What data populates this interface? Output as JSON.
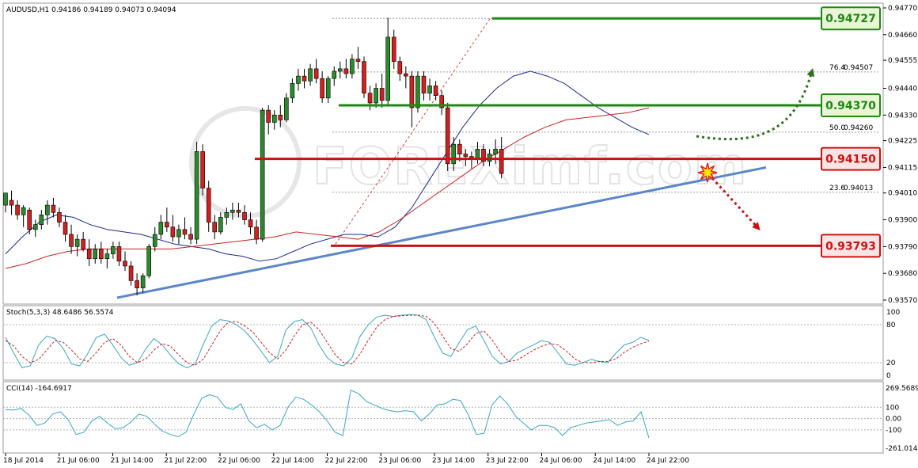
{
  "chart_data": {
    "type": "candlestick",
    "symbol_header": "AUDUSD,H1  0.94186 0.94189 0.94073 0.94094",
    "watermark": "FOREXimf.com",
    "x_ticks": [
      "18 Jul 2014",
      "21 Jul 06:00",
      "21 Jul 14:00",
      "21 Jul 22:00",
      "22 Jul 06:00",
      "22 Jul 14:00",
      "22 Jul 22:00",
      "23 Jul 06:00",
      "23 Jul 14:00",
      "23 Jul 22:00",
      "24 Jul 06:00",
      "24 Jul 14:00",
      "24 Jul 22:00"
    ],
    "y_ticks": [
      "0.94770",
      "0.94660",
      "0.94555",
      "0.94440",
      "0.94330",
      "0.94225",
      "0.94115",
      "0.94010",
      "0.93900",
      "0.93790",
      "0.93680",
      "0.93570"
    ],
    "ylim": [
      0.9357,
      0.9477
    ],
    "levels": [
      {
        "label": "0.94727",
        "value": 0.94727,
        "color": "#1e8a12",
        "kind": "resistance"
      },
      {
        "label": "0.94370",
        "value": 0.9437,
        "color": "#1e8a12",
        "kind": "resistance"
      },
      {
        "label": "0.94150",
        "value": 0.9415,
        "color": "#cc1111",
        "kind": "support"
      },
      {
        "label": "0.93793",
        "value": 0.93793,
        "color": "#cc1111",
        "kind": "support"
      }
    ],
    "fib_levels": [
      {
        "ratio": "76.4",
        "value_label": "0.94507",
        "value": 0.94507
      },
      {
        "ratio": "50.0",
        "value_label": "0.94260",
        "value": 0.9426
      },
      {
        "ratio": "23.6",
        "value_label": "0.94013",
        "value": 0.94013
      }
    ],
    "candles": [
      [
        0.9396,
        0.94,
        0.9393,
        0.9401
      ],
      [
        0.9398,
        0.9402,
        0.9392,
        0.9396
      ],
      [
        0.9396,
        0.9398,
        0.939,
        0.9392
      ],
      [
        0.9392,
        0.9396,
        0.9387,
        0.9395
      ],
      [
        0.9394,
        0.9395,
        0.9384,
        0.9386
      ],
      [
        0.9386,
        0.939,
        0.9383,
        0.9388
      ],
      [
        0.9388,
        0.9394,
        0.9386,
        0.9392
      ],
      [
        0.9392,
        0.9398,
        0.9388,
        0.9396
      ],
      [
        0.9396,
        0.9399,
        0.9391,
        0.9393
      ],
      [
        0.9393,
        0.9395,
        0.9387,
        0.9389
      ],
      [
        0.9389,
        0.9392,
        0.9381,
        0.9384
      ],
      [
        0.9384,
        0.9388,
        0.9376,
        0.9379
      ],
      [
        0.9379,
        0.9384,
        0.9375,
        0.9382
      ],
      [
        0.9382,
        0.9385,
        0.9377,
        0.9378
      ],
      [
        0.9378,
        0.9382,
        0.9371,
        0.9374
      ],
      [
        0.9374,
        0.938,
        0.9372,
        0.9378
      ],
      [
        0.9378,
        0.9381,
        0.9372,
        0.9374
      ],
      [
        0.9374,
        0.9378,
        0.937,
        0.9376
      ],
      [
        0.9376,
        0.9381,
        0.9374,
        0.9379
      ],
      [
        0.9379,
        0.9381,
        0.9371,
        0.9373
      ],
      [
        0.9373,
        0.9377,
        0.9369,
        0.9371
      ],
      [
        0.9371,
        0.9373,
        0.9363,
        0.9365
      ],
      [
        0.9365,
        0.9368,
        0.9359,
        0.9362
      ],
      [
        0.9362,
        0.9368,
        0.936,
        0.9367
      ],
      [
        0.9367,
        0.938,
        0.9366,
        0.9379
      ],
      [
        0.9379,
        0.9387,
        0.9377,
        0.9384
      ],
      [
        0.9384,
        0.9392,
        0.9382,
        0.9389
      ],
      [
        0.9389,
        0.9395,
        0.9385,
        0.9387
      ],
      [
        0.9387,
        0.9392,
        0.9381,
        0.9383
      ],
      [
        0.9383,
        0.9388,
        0.938,
        0.9386
      ],
      [
        0.9386,
        0.9391,
        0.9382,
        0.9384
      ],
      [
        0.9384,
        0.9387,
        0.938,
        0.9382
      ],
      [
        0.9382,
        0.9422,
        0.938,
        0.9418
      ],
      [
        0.9418,
        0.9421,
        0.94,
        0.9403
      ],
      [
        0.9403,
        0.9406,
        0.9385,
        0.9389
      ],
      [
        0.9389,
        0.9392,
        0.9382,
        0.9385
      ],
      [
        0.9385,
        0.9393,
        0.9384,
        0.9391
      ],
      [
        0.9391,
        0.9395,
        0.9388,
        0.9393
      ],
      [
        0.9393,
        0.9397,
        0.939,
        0.9394
      ],
      [
        0.9394,
        0.9397,
        0.9391,
        0.9393
      ],
      [
        0.9393,
        0.9396,
        0.9388,
        0.939
      ],
      [
        0.939,
        0.9393,
        0.9384,
        0.9387
      ],
      [
        0.9387,
        0.939,
        0.938,
        0.9382
      ],
      [
        0.9382,
        0.9436,
        0.9381,
        0.9435
      ],
      [
        0.9435,
        0.9437,
        0.9425,
        0.943
      ],
      [
        0.943,
        0.9435,
        0.9427,
        0.9433
      ],
      [
        0.9433,
        0.9437,
        0.9428,
        0.9431
      ],
      [
        0.9431,
        0.9442,
        0.943,
        0.944
      ],
      [
        0.944,
        0.9448,
        0.9438,
        0.9446
      ],
      [
        0.9446,
        0.9452,
        0.9443,
        0.9449
      ],
      [
        0.9449,
        0.9452,
        0.9444,
        0.9447
      ],
      [
        0.9447,
        0.9454,
        0.9445,
        0.9452
      ],
      [
        0.9452,
        0.9456,
        0.9446,
        0.9448
      ],
      [
        0.9448,
        0.9451,
        0.9438,
        0.944
      ],
      [
        0.944,
        0.9449,
        0.9438,
        0.9448
      ],
      [
        0.9448,
        0.9453,
        0.9445,
        0.9451
      ],
      [
        0.9451,
        0.9455,
        0.9448,
        0.9452
      ],
      [
        0.9452,
        0.9456,
        0.9448,
        0.945
      ],
      [
        0.945,
        0.9458,
        0.9448,
        0.9456
      ],
      [
        0.9456,
        0.9461,
        0.9452,
        0.9455
      ],
      [
        0.9455,
        0.9457,
        0.944,
        0.9442
      ],
      [
        0.9442,
        0.9445,
        0.9435,
        0.9438
      ],
      [
        0.9438,
        0.9446,
        0.9436,
        0.9444
      ],
      [
        0.9444,
        0.945,
        0.9436,
        0.9439
      ],
      [
        0.9439,
        0.9473,
        0.9437,
        0.9465
      ],
      [
        0.9465,
        0.9468,
        0.9452,
        0.9455
      ],
      [
        0.9455,
        0.9457,
        0.9447,
        0.945
      ],
      [
        0.945,
        0.9453,
        0.9444,
        0.9449
      ],
      [
        0.9449,
        0.9451,
        0.9428,
        0.9436
      ],
      [
        0.9436,
        0.9451,
        0.9434,
        0.9449
      ],
      [
        0.9449,
        0.9451,
        0.9439,
        0.9442
      ],
      [
        0.9442,
        0.9448,
        0.9439,
        0.9445
      ],
      [
        0.9445,
        0.9447,
        0.9439,
        0.9441
      ],
      [
        0.9441,
        0.9443,
        0.9433,
        0.9436
      ],
      [
        0.9436,
        0.9438,
        0.941,
        0.9413
      ],
      [
        0.9413,
        0.9424,
        0.941,
        0.9421
      ],
      [
        0.9421,
        0.9423,
        0.9414,
        0.9417
      ],
      [
        0.9417,
        0.9419,
        0.9412,
        0.9416
      ],
      [
        0.9416,
        0.9418,
        0.9411,
        0.9415
      ],
      [
        0.9415,
        0.9422,
        0.9413,
        0.9419
      ],
      [
        0.9419,
        0.9421,
        0.9412,
        0.9414
      ],
      [
        0.9414,
        0.9419,
        0.9412,
        0.9417
      ],
      [
        0.9417,
        0.9423,
        0.9413,
        0.9419
      ],
      [
        0.9419,
        0.9424,
        0.9407,
        0.9409
      ]
    ],
    "ma_fast": [
      0.9376,
      0.9383,
      0.9389,
      0.9392,
      0.9391,
      0.9388,
      0.9386,
      0.9385,
      0.9384,
      0.9382,
      0.938,
      0.9379,
      0.9378,
      0.9376,
      0.9375,
      0.9373,
      0.9374,
      0.9377,
      0.938,
      0.9382,
      0.9384,
      0.9384,
      0.9383,
      0.9387,
      0.9395,
      0.9406,
      0.9417,
      0.9428,
      0.9437,
      0.9444,
      0.9449,
      0.9451,
      0.9449,
      0.9446,
      0.9441,
      0.9436,
      0.9432,
      0.9428,
      0.9425
    ],
    "ma_slow": [
      0.937,
      0.9372,
      0.9375,
      0.9377,
      0.9378,
      0.9378,
      0.9378,
      0.9378,
      0.9378,
      0.9379,
      0.938,
      0.9381,
      0.9382,
      0.9383,
      0.9385,
      0.9384,
      0.9383,
      0.9382,
      0.9385,
      0.939,
      0.9396,
      0.9402,
      0.9408,
      0.9414,
      0.9419,
      0.9424,
      0.9428,
      0.9431,
      0.9432,
      0.9433,
      0.9434,
      0.9436
    ],
    "stoch": {
      "header": "Stoch(5,3,3) 48.6486 56.5574",
      "y_ticks": [
        "100",
        "80",
        "20",
        "0"
      ],
      "k": [
        60,
        35,
        12,
        15,
        48,
        62,
        58,
        42,
        18,
        15,
        35,
        60,
        65,
        48,
        28,
        16,
        20,
        42,
        58,
        48,
        32,
        18,
        12,
        18,
        50,
        78,
        88,
        86,
        80,
        70,
        55,
        38,
        20,
        30,
        72,
        85,
        88,
        75,
        48,
        28,
        18,
        15,
        28,
        62,
        80,
        92,
        95,
        93,
        95,
        96,
        95,
        88,
        60,
        35,
        30,
        52,
        72,
        78,
        55,
        30,
        18,
        22,
        35,
        42,
        48,
        55,
        52,
        35,
        18,
        16,
        20,
        25,
        22,
        20,
        35,
        48,
        52,
        60,
        55
      ],
      "d": [
        55,
        46,
        30,
        20,
        25,
        40,
        55,
        52,
        40,
        26,
        22,
        36,
        52,
        58,
        48,
        30,
        20,
        26,
        40,
        50,
        46,
        32,
        20,
        16,
        26,
        48,
        70,
        84,
        85,
        78,
        68,
        52,
        36,
        26,
        40,
        62,
        80,
        84,
        72,
        52,
        32,
        20,
        18,
        34,
        56,
        76,
        88,
        93,
        94,
        95,
        95,
        93,
        82,
        62,
        42,
        38,
        50,
        66,
        70,
        56,
        36,
        22,
        24,
        32,
        40,
        46,
        50,
        48,
        38,
        26,
        20,
        20,
        22,
        22,
        26,
        36,
        44,
        50,
        54
      ]
    },
    "cci": {
      "header": "CCI(14) -164.6917",
      "y_ticks": [
        "269.5689",
        "100",
        "0.00",
        "-100",
        "-261.0149"
      ],
      "values": [
        80,
        75,
        90,
        30,
        -60,
        -40,
        40,
        60,
        -10,
        -140,
        -120,
        -20,
        20,
        -40,
        -90,
        -80,
        -30,
        40,
        20,
        -50,
        -110,
        -140,
        -160,
        -120,
        40,
        180,
        210,
        190,
        100,
        80,
        130,
        -20,
        -80,
        -50,
        -100,
        -60,
        100,
        190,
        170,
        120,
        60,
        -20,
        -120,
        -150,
        250,
        220,
        150,
        120,
        90,
        70,
        60,
        70,
        60,
        -20,
        40,
        120,
        130,
        170,
        160,
        30,
        -140,
        -130,
        120,
        200,
        130,
        20,
        -40,
        -100,
        -60,
        -60,
        -80,
        -150,
        -80,
        -60,
        -40,
        -30,
        -20,
        -10,
        -60,
        -30,
        -20,
        60,
        -170
      ]
    }
  }
}
